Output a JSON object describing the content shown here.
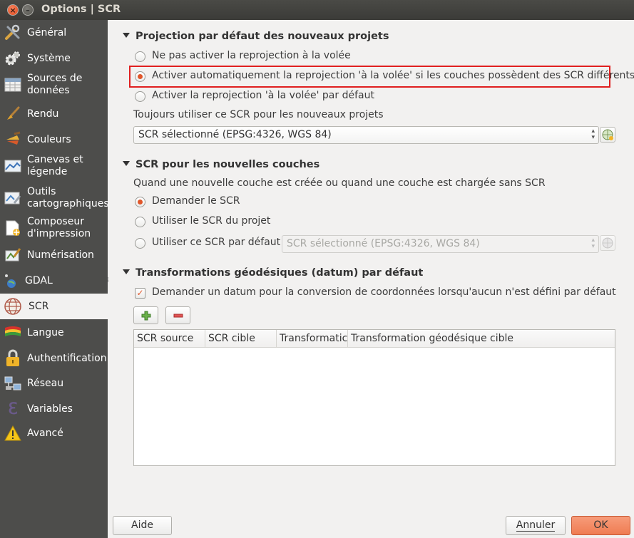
{
  "window": {
    "title": "Options | SCR"
  },
  "sidebar": {
    "items": [
      {
        "label": "Général",
        "icon": "tools-icon"
      },
      {
        "label": "Système",
        "icon": "gear-icon"
      },
      {
        "label": "Sources de données",
        "icon": "table-icon"
      },
      {
        "label": "Rendu",
        "icon": "brush-icon"
      },
      {
        "label": "Couleurs",
        "icon": "palette-icon"
      },
      {
        "label": "Canevas et légende",
        "icon": "map-icon"
      },
      {
        "label": "Outils cartographiques",
        "icon": "map-tools-icon"
      },
      {
        "label": "Composeur d'impression",
        "icon": "composer-icon"
      },
      {
        "label": "Numérisation",
        "icon": "digitize-icon"
      },
      {
        "label": "GDAL",
        "icon": "gdal-icon"
      },
      {
        "label": "SCR",
        "icon": "globe-icon",
        "selected": true
      },
      {
        "label": "Langue",
        "icon": "flag-icon"
      },
      {
        "label": "Authentification",
        "icon": "lock-icon"
      },
      {
        "label": "Réseau",
        "icon": "network-icon"
      },
      {
        "label": "Variables",
        "icon": "epsilon-icon"
      },
      {
        "label": "Avancé",
        "icon": "warning-icon"
      }
    ]
  },
  "projection": {
    "header": "Projection par défaut des nouveaux projets",
    "options": [
      "Ne pas activer la reprojection à la volée",
      "Activer automatiquement la reprojection 'à la volée' si les couches possèdent des SCR différents",
      "Activer la reprojection 'à la volée' par défaut"
    ],
    "always_label": "Toujours utiliser ce SCR pour les nouveaux projets",
    "crs_value": "SCR sélectionné (EPSG:4326, WGS 84)"
  },
  "layers": {
    "header": "SCR pour les nouvelles couches",
    "description": "Quand une nouvelle couche est créée ou quand une couche est chargée sans SCR",
    "options": [
      "Demander le SCR",
      "Utiliser le SCR du projet",
      "Utiliser ce SCR par défaut"
    ],
    "crs_value": "SCR sélectionné (EPSG:4326, WGS 84)"
  },
  "datum": {
    "header": "Transformations géodésiques (datum) par défaut",
    "ask_label": "Demander un datum pour la conversion de coordonnées lorsqu'aucun n'est défini par défaut",
    "columns": [
      "SCR source",
      "SCR cible",
      "Transformatic",
      "Transformation géodésique cible"
    ]
  },
  "footer": {
    "help": "Aide",
    "cancel": "Annuler",
    "ok": "OK"
  },
  "colors": {
    "accent": "#e0562a",
    "highlight_box": "#e01f1f",
    "sidebar_bg": "#4d4d4b"
  }
}
